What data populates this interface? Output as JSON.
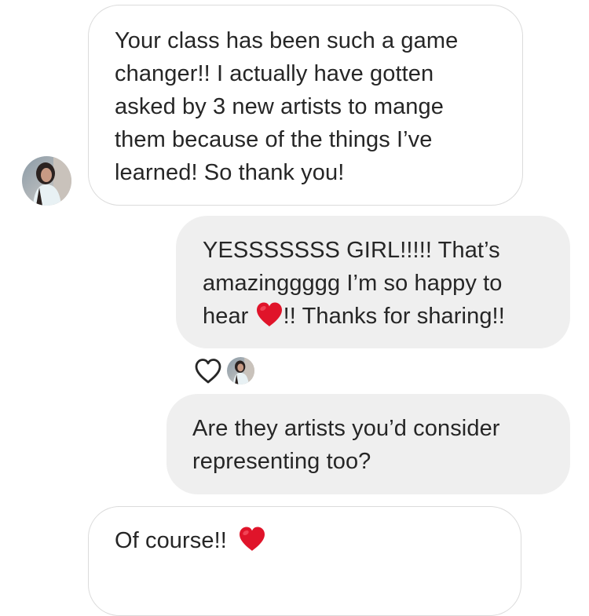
{
  "messages": [
    {
      "direction": "received",
      "lines": [
        "Your class has been such a game",
        "changer!! I actually have gotten",
        "asked by 3 new artists to mange",
        "them because of the things I’ve",
        "learned! So thank you!"
      ]
    },
    {
      "direction": "sent",
      "lines": [
        "YESSSSSSS GIRL!!!!! That’s",
        "amazinggggg I’m so happy to"
      ],
      "line3_before": "hear",
      "line3_after": "!! Thanks for sharing!!"
    },
    {
      "direction": "sent",
      "lines": [
        "Are they artists you’d consider",
        "representing too?"
      ]
    },
    {
      "direction": "received",
      "text": "Of course!!"
    }
  ],
  "icons": {
    "emoji_heart": "red-heart-emoji",
    "reaction": "heart-outline-icon",
    "avatar": "contact-avatar"
  },
  "colors": {
    "text": "#262626",
    "received_border": "#dbdbdb",
    "sent_background": "#efefef",
    "heart_red": "#e0142a"
  }
}
